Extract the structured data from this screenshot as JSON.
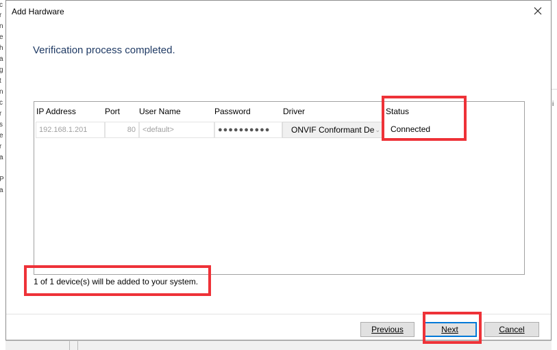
{
  "background": {
    "left_fragments": [
      "c",
      "r",
      "n",
      "e",
      "h",
      "a",
      "g",
      "t",
      "n",
      "c",
      "r",
      "s",
      "e",
      "r",
      "a",
      "P",
      "a"
    ],
    "right_fragment": "i"
  },
  "dialog": {
    "title": "Add Hardware",
    "close_icon": "close-icon",
    "heading": "Verification process completed.",
    "table": {
      "headers": {
        "ip": "IP Address",
        "port": "Port",
        "user": "User Name",
        "password": "Password",
        "driver": "Driver",
        "status": "Status"
      },
      "row": {
        "ip": "192.168.1.201",
        "port": "80",
        "user": "<default>",
        "password": "●●●●●●●●●●",
        "driver": "ONVIF Conformant De",
        "status": "Connected"
      }
    },
    "summary": "1 of 1 device(s) will be added to your system.",
    "buttons": {
      "previous": "Previous",
      "next": "Next",
      "cancel": "Cancel"
    }
  },
  "colors": {
    "annotation": "#ee3238",
    "heading": "#1f3a64",
    "primary_border": "#0078d7"
  }
}
